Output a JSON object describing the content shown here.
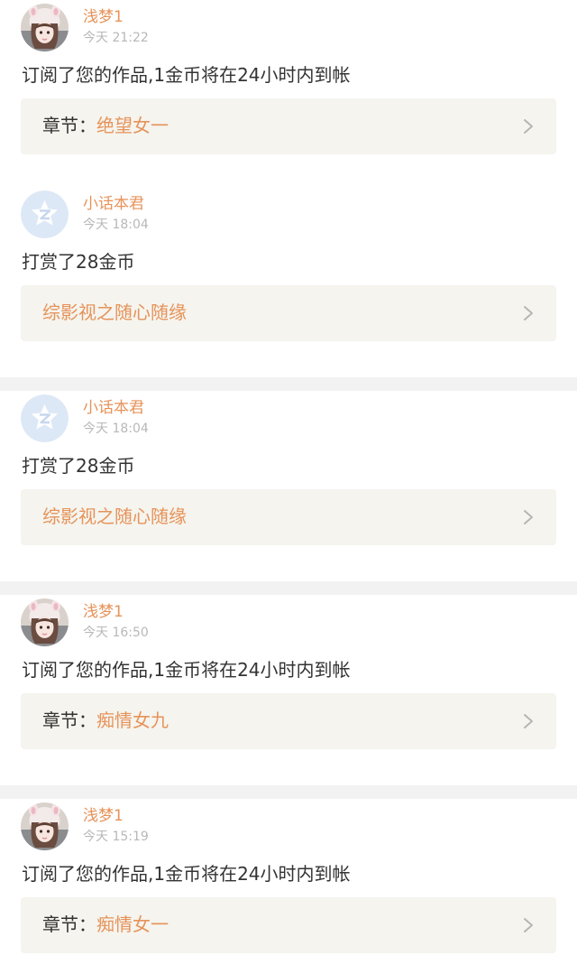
{
  "colors": {
    "accent": "#e6935a",
    "text": "#333333",
    "muted": "#b8b8b8",
    "box_bg": "#f5f4ee",
    "separator": "#f2f2f2"
  },
  "notifications": [
    {
      "avatar": "girl-avatar",
      "username": "浅梦1",
      "time": "今天 21:22",
      "message": "订阅了您的作品,1金币将在24小时内到帐",
      "link_prefix": "章节：",
      "link_title": "绝望女一"
    },
    {
      "avatar": "default-avatar",
      "username": "小话本君",
      "time": "今天 18:04",
      "message": "打赏了28金币",
      "link_prefix": "",
      "link_title": "综影视之随心随缘"
    },
    {
      "avatar": "default-avatar",
      "username": "小话本君",
      "time": "今天 18:04",
      "message": "打赏了28金币",
      "link_prefix": "",
      "link_title": "综影视之随心随缘"
    },
    {
      "avatar": "girl-avatar",
      "username": "浅梦1",
      "time": "今天 16:50",
      "message": "订阅了您的作品,1金币将在24小时内到帐",
      "link_prefix": "章节：",
      "link_title": "痴情女九"
    },
    {
      "avatar": "girl-avatar",
      "username": "浅梦1",
      "time": "今天 15:19",
      "message": "订阅了您的作品,1金币将在24小时内到帐",
      "link_prefix": "章节：",
      "link_title": "痴情女一"
    }
  ]
}
